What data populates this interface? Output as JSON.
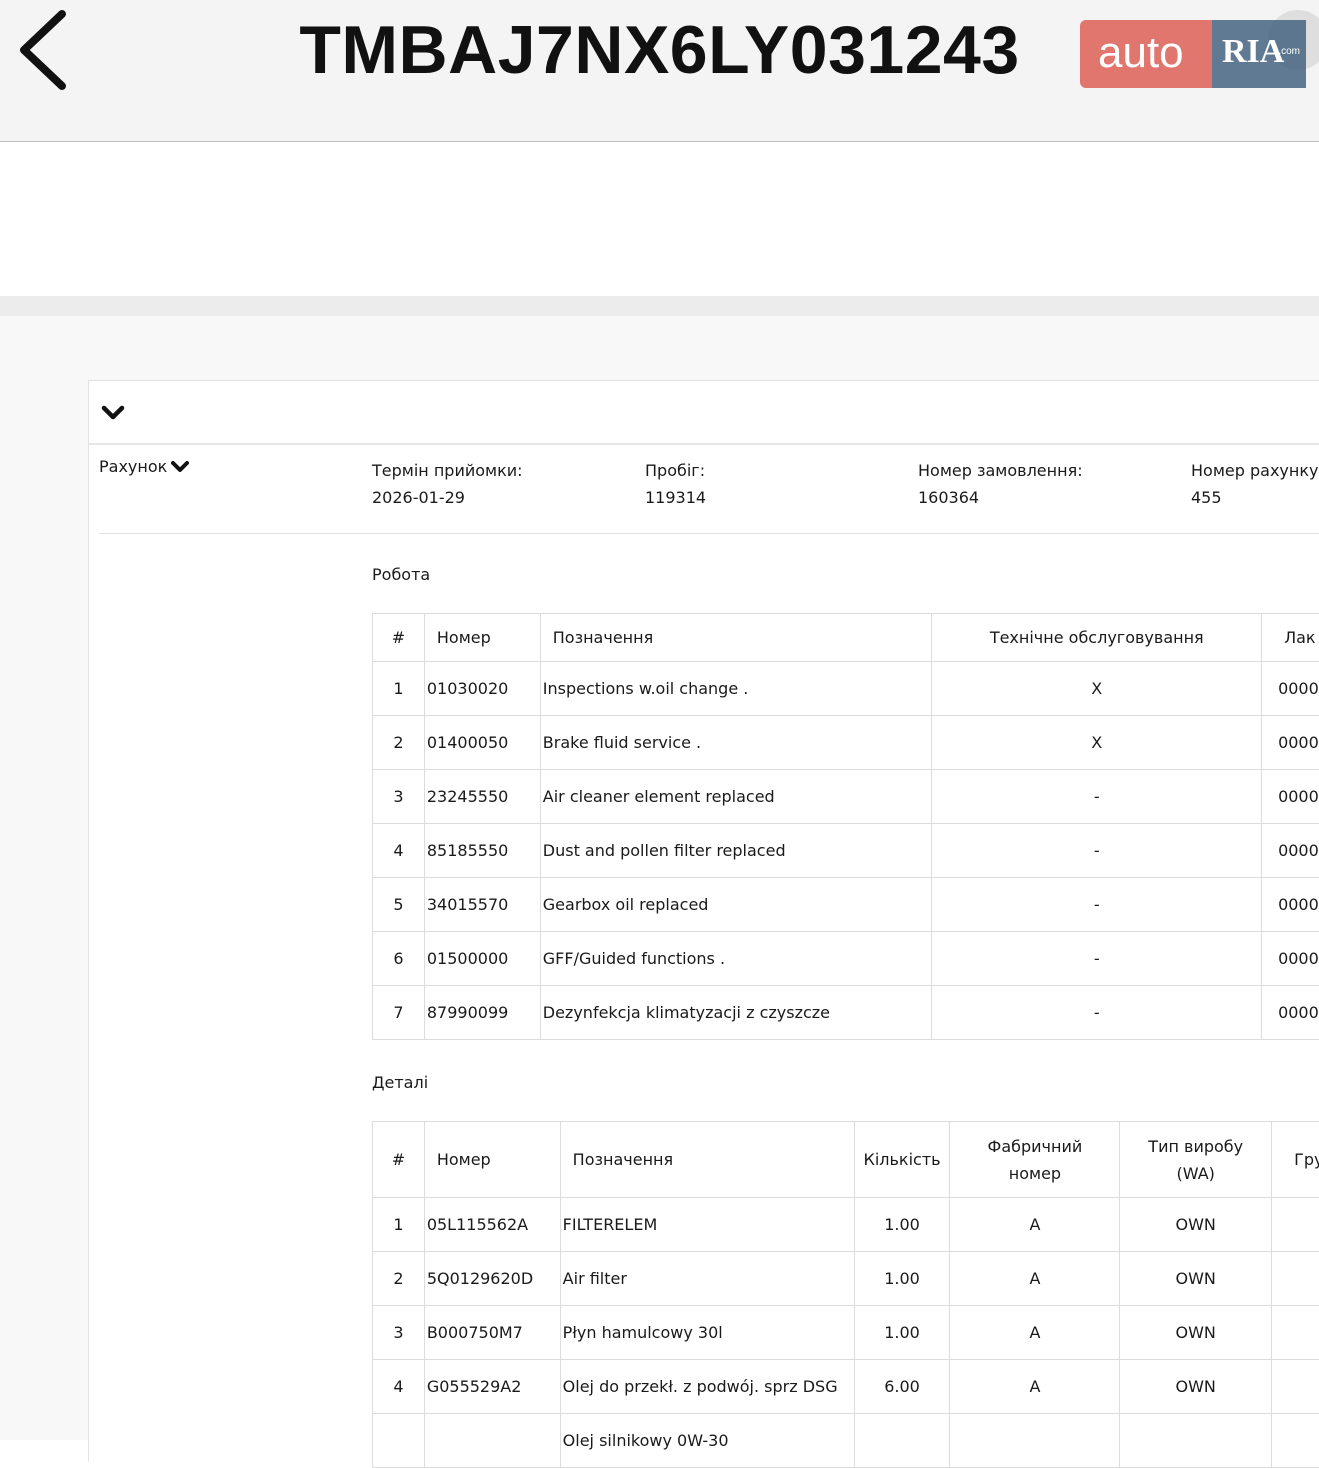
{
  "header": {
    "back_icon": "chevron-left-icon",
    "vin": "TMBAJ7NX6LY031243"
  },
  "watermark": {
    "auto": "auto",
    "ria": "RIA",
    "com": ".com"
  },
  "card": {
    "toggle_icon": "chevron-down-icon"
  },
  "invoice": {
    "toggle_label": "Рахунок",
    "fields": [
      {
        "label": "Термін прийомки:",
        "value": "2026-01-29"
      },
      {
        "label": "Пробіг:",
        "value": "119314"
      },
      {
        "label": "Номер замовлення:",
        "value": "160364"
      },
      {
        "label": "Номер рахунку:",
        "value": "455"
      }
    ]
  },
  "work": {
    "title": "Робота",
    "columns": [
      "#",
      "Номер",
      "Позначення",
      "Технічне обслуговування",
      "Лак"
    ],
    "rows": [
      [
        "1",
        "01030020",
        "Inspections w.oil change .",
        "X",
        "0000"
      ],
      [
        "2",
        "01400050",
        "Brake fluid service .",
        "X",
        "0000"
      ],
      [
        "3",
        "23245550",
        "Air cleaner element replaced",
        "-",
        "0000"
      ],
      [
        "4",
        "85185550",
        "Dust and pollen filter replaced",
        "-",
        "0000"
      ],
      [
        "5",
        "34015570",
        "Gearbox oil replaced",
        "-",
        "0000"
      ],
      [
        "6",
        "01500000",
        "GFF/Guided functions .",
        "-",
        "0000"
      ],
      [
        "7",
        "87990099",
        "Dezynfekcja klimatyzacji z czyszcze",
        "-",
        "0000"
      ]
    ]
  },
  "parts": {
    "title": "Деталі",
    "columns": [
      "#",
      "Номер",
      "Позначення",
      "Кількість",
      "Фабричний номер",
      "Тип виробу (WA)",
      "Гру"
    ],
    "rows": [
      [
        "1",
        "05L115562A",
        "FILTERELEM",
        "1.00",
        "A",
        "OWN"
      ],
      [
        "2",
        "5Q0129620D",
        "Air filter",
        "1.00",
        "A",
        "OWN"
      ],
      [
        "3",
        "B000750M7",
        "Płyn hamulcowy 30l",
        "1.00",
        "A",
        "OWN"
      ],
      [
        "4",
        "G055529A2",
        "Olej do przekł. z podwój. sprz DSG",
        "6.00",
        "A",
        "OWN"
      ],
      [
        "",
        "",
        "Olej silnikowy 0W-30",
        "",
        "",
        ""
      ]
    ]
  }
}
